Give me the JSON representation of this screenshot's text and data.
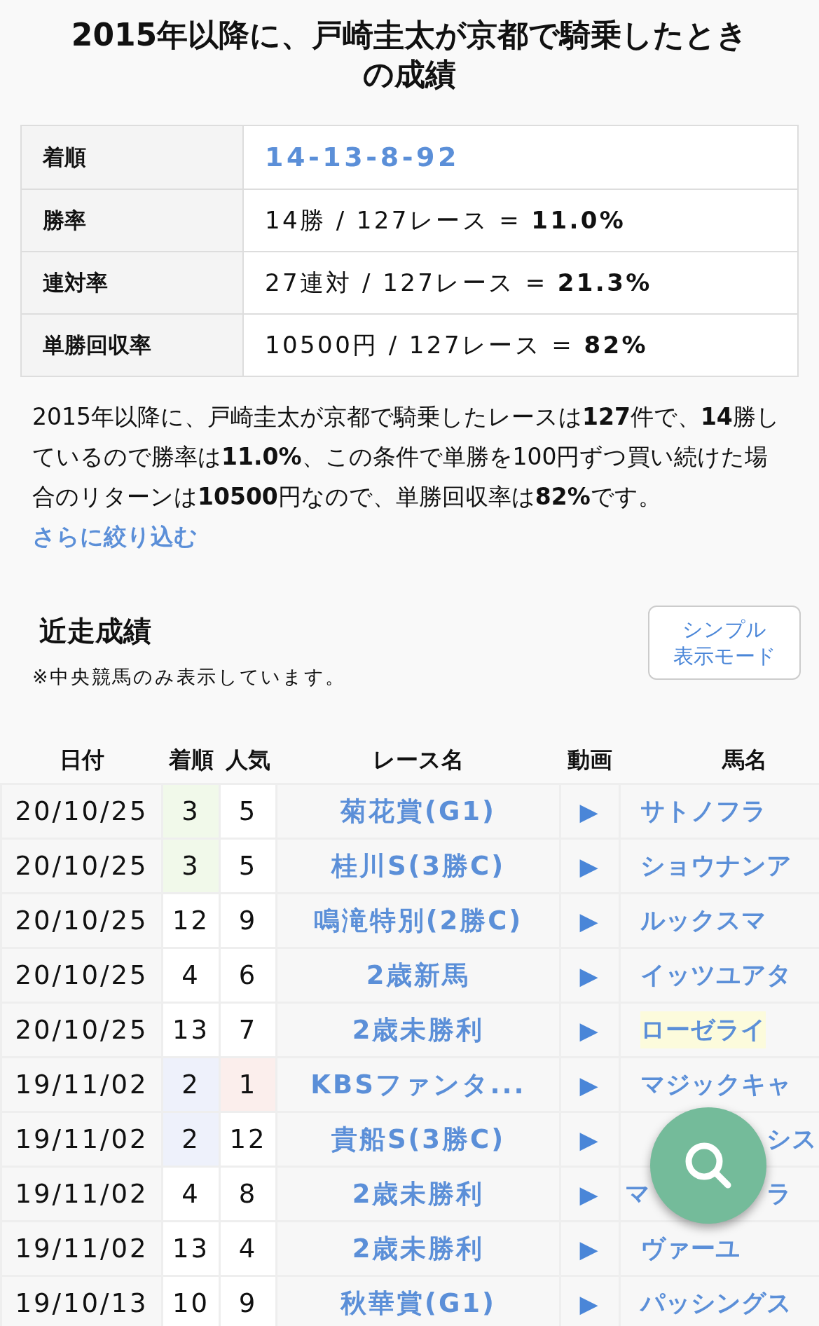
{
  "title": "2015年以降に、戸崎圭太が京都で騎乗したときの成績",
  "summary": [
    {
      "label": "着順",
      "value": "14-13-8-92",
      "kind": "link"
    },
    {
      "label": "勝率",
      "value": "14勝 / 127レース = **11.0%**",
      "kind": "text"
    },
    {
      "label": "連対率",
      "value": "27連対 / 127レース = **21.3%**",
      "kind": "text"
    },
    {
      "label": "単勝回収率",
      "value": "10500円 / 127レース = **82%**",
      "kind": "text"
    }
  ],
  "description": "2015年以降に、戸崎圭太が京都で騎乗したレースは**127**件で、**14**勝しているので勝率は**11.0%**、この条件で単勝を100円ずつ買い続けた場合のリターンは**10500**円なので、単勝回収率は**82%**です。",
  "refine_link": "さらに絞り込む",
  "recent": {
    "heading": "近走成績",
    "note": "※中央競馬のみ表示しています。",
    "mode_button": [
      "シンプル",
      "表示モード"
    ],
    "columns": [
      "日付",
      "着順",
      "人気",
      "レース名",
      "動画",
      "馬名"
    ],
    "rows": [
      {
        "date": "20/10/25",
        "rank": {
          "text": "3",
          "color": "#f1f9ea"
        },
        "pop": {
          "text": "5"
        },
        "race": "菊花賞(G1)",
        "video": "▶",
        "horse": {
          "kind": "plain",
          "after": "サトノフラ"
        }
      },
      {
        "date": "20/10/25",
        "rank": {
          "text": "3",
          "color": "#f1f9ea"
        },
        "pop": {
          "text": "5"
        },
        "race": "桂川S(3勝C)",
        "video": "▶",
        "horse": {
          "kind": "plain",
          "after": "ショウナンア"
        }
      },
      {
        "date": "20/10/25",
        "rank": {
          "text": "12"
        },
        "pop": {
          "text": "9"
        },
        "race": "鳴滝特別(2勝C)",
        "video": "▶",
        "horse": {
          "kind": "plain",
          "after": "ルックスマ"
        }
      },
      {
        "date": "20/10/25",
        "rank": {
          "text": "4"
        },
        "pop": {
          "text": "6"
        },
        "race": "2歳新馬",
        "video": "▶",
        "horse": {
          "kind": "plain",
          "after": "イッツユアタ"
        }
      },
      {
        "date": "20/10/25",
        "rank": {
          "text": "13"
        },
        "pop": {
          "text": "7"
        },
        "race": "2歳未勝利",
        "video": "▶",
        "horse": {
          "kind": "plain",
          "after": "ローゼライ",
          "color": "#fcfbdc"
        }
      },
      {
        "date": "19/11/02",
        "rank": {
          "text": "2",
          "color": "#eef1fb"
        },
        "pop": {
          "text": "1",
          "color": "#fbeeec"
        },
        "race": "KBSファンタ...",
        "video": "▶",
        "horse": {
          "kind": "plain",
          "after": "マジックキャ"
        }
      },
      {
        "date": "19/11/02",
        "rank": {
          "text": "2",
          "color": "#eef1fb"
        },
        "pop": {
          "text": "12"
        },
        "race": "貴船S(3勝C)",
        "video": "▶",
        "horse": {
          "kind": "split",
          "after": "シス"
        }
      },
      {
        "date": "19/11/02",
        "rank": {
          "text": "4"
        },
        "pop": {
          "text": "8"
        },
        "race": "2歳未勝利",
        "video": "▶",
        "horse": {
          "kind": "split",
          "before": "マ",
          "after": "ラ"
        }
      },
      {
        "date": "19/11/02",
        "rank": {
          "text": "13"
        },
        "pop": {
          "text": "4"
        },
        "race": "2歳未勝利",
        "video": "▶",
        "horse": {
          "kind": "plain",
          "after": "ヴァーユ"
        }
      },
      {
        "date": "19/10/13",
        "rank": {
          "text": "10"
        },
        "pop": {
          "text": "9"
        },
        "race": "秋華賞(G1)",
        "video": "▶",
        "horse": {
          "kind": "plain",
          "after": "パッシングス"
        }
      }
    ]
  }
}
